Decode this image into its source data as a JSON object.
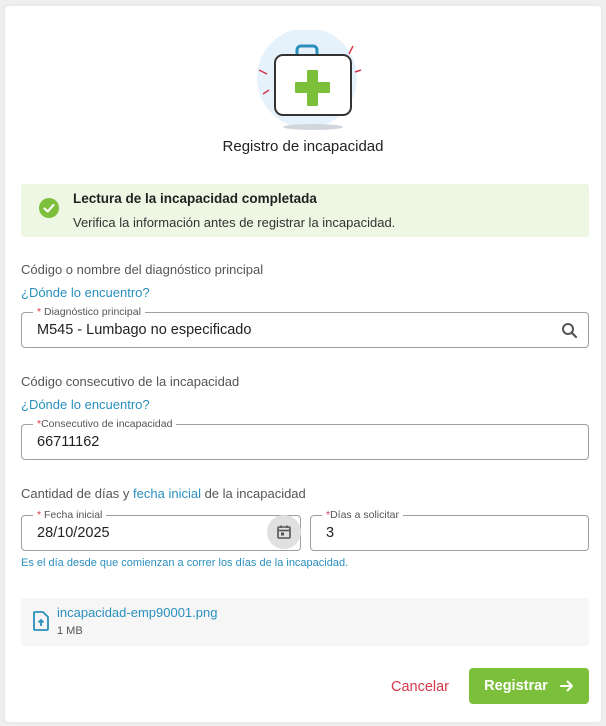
{
  "header": {
    "illustration": "first-aid-kit-icon",
    "title": "Registro de incapacidad"
  },
  "alert": {
    "icon": "check-circle-icon",
    "title": "Lectura de la incapacidad completada",
    "message": "Verifica la información antes de registrar la incapacidad."
  },
  "diagnostic": {
    "label": "Código o nombre del diagnóstico principal",
    "help_link": "¿Dónde lo encuentro?",
    "field_required": "*",
    "field_label": "Diagnóstico principal",
    "value": "M545 - Lumbago no especificado",
    "icon": "search-icon"
  },
  "consecutive": {
    "label": "Código consecutivo de la incapacidad",
    "help_link": "¿Dónde lo encuentro?",
    "field_required": "*",
    "field_label": "Consecutivo de incapacidad",
    "value": "66711162"
  },
  "dates": {
    "label_prefix": "Cantidad de días y ",
    "label_highlight": "fecha inicial",
    "label_suffix": " de la incapacidad",
    "start_required": "*",
    "start_label": "Fecha inicial",
    "start_value": "28/10/2025",
    "start_icon": "calendar-icon",
    "days_required": "*",
    "days_label": "Días a solicitar",
    "days_value": "3",
    "hint": "Es el día desde que comienzan a correr los días de la incapacidad."
  },
  "file": {
    "icon": "file-upload-icon",
    "name": "incapacidad-emp90001.png",
    "size": "1 MB"
  },
  "actions": {
    "cancel_label": "Cancelar",
    "submit_label": "Registrar",
    "submit_icon": "arrow-right-icon"
  },
  "colors": {
    "accent_green": "#7bbf3a",
    "link_blue": "#2a8fbd",
    "danger_red": "#d6374a",
    "alert_bg": "#eef7e3"
  }
}
